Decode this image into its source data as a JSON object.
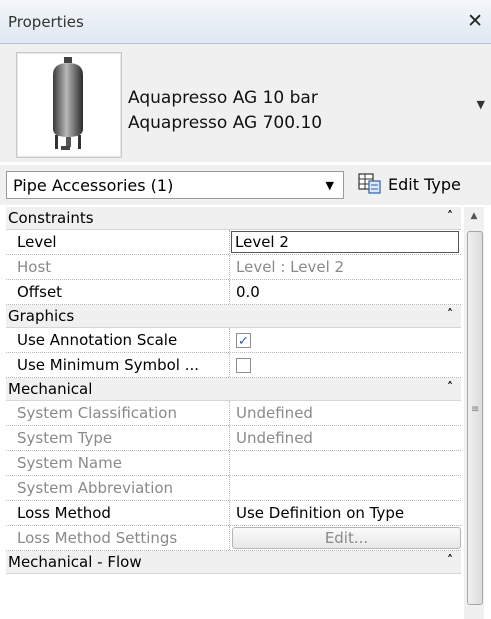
{
  "panel": {
    "title": "Properties",
    "close_glyph": "✕"
  },
  "type_selector": {
    "line1": "Aquapresso AG 10 bar",
    "line2": "Aquapresso AG 700.10",
    "dropdown_icon": "triangle-down"
  },
  "instance_selector": {
    "label": "Pipe Accessories (1)",
    "dropdown_icon": "triangle-down"
  },
  "edit_type": {
    "label": "Edit Type",
    "icon": "edit-type-icon"
  },
  "sections": {
    "constraints": {
      "label": "Constraints",
      "collapse_glyph": "˄"
    },
    "graphics": {
      "label": "Graphics",
      "collapse_glyph": "˄"
    },
    "mechanical": {
      "label": "Mechanical",
      "collapse_glyph": "˄"
    },
    "mechanical_flow": {
      "label": "Mechanical - Flow",
      "collapse_glyph": "˄"
    }
  },
  "properties": {
    "level": {
      "name": "Level",
      "value": "Level 2"
    },
    "host": {
      "name": "Host",
      "value": "Level : Level 2"
    },
    "offset": {
      "name": "Offset",
      "value": "0.0"
    },
    "use_annotation_scale": {
      "name": "Use Annotation Scale",
      "checked": true
    },
    "use_minimum_symbol": {
      "name": "Use Minimum Symbol ...",
      "checked": false
    },
    "system_classification": {
      "name": "System Classification",
      "value": "Undefined"
    },
    "system_type": {
      "name": "System Type",
      "value": "Undefined"
    },
    "system_name": {
      "name": "System Name",
      "value": ""
    },
    "system_abbreviation": {
      "name": "System Abbreviation",
      "value": ""
    },
    "loss_method": {
      "name": "Loss Method",
      "value": "Use Definition on Type"
    },
    "loss_method_settings": {
      "name": "Loss Method Settings",
      "button": "Edit..."
    }
  },
  "colors": {
    "titlebar": "#dfe7f1",
    "section_bg": "#f0f0f0",
    "disabled_text": "#8a8a8a",
    "check_accent": "#2e5aa7"
  }
}
